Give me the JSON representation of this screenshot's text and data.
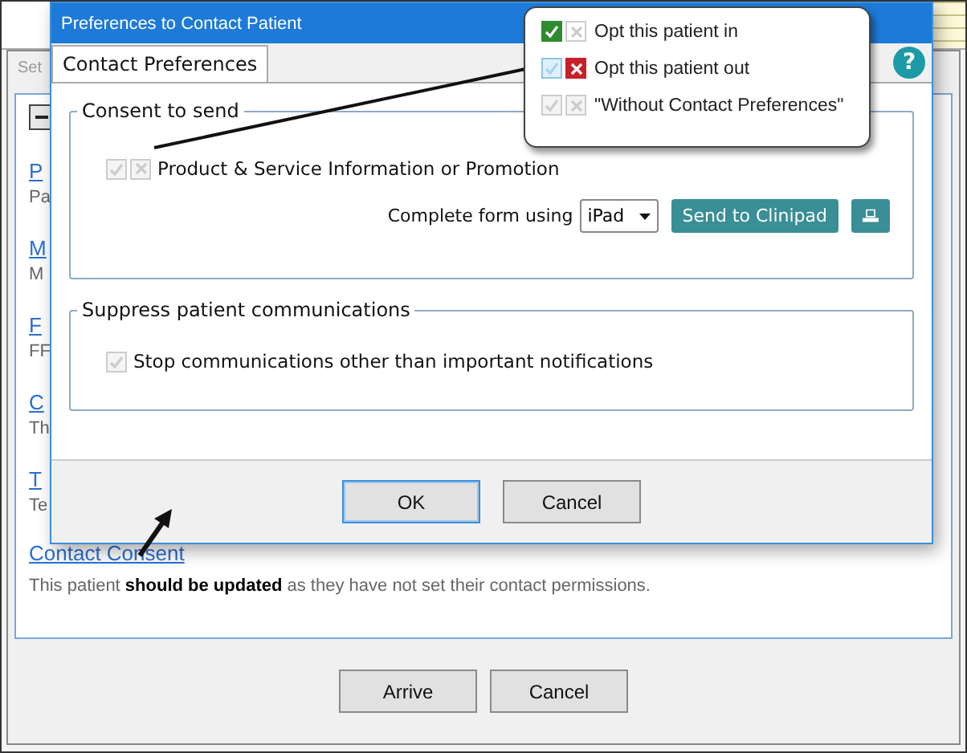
{
  "background_window": {
    "tab": "Set",
    "items": [
      {
        "kind": "link",
        "text": "P"
      },
      {
        "kind": "text",
        "text": "Pa"
      },
      {
        "kind": "link",
        "text": "M"
      },
      {
        "kind": "text",
        "text": "M"
      },
      {
        "kind": "link",
        "text": "F"
      },
      {
        "kind": "text",
        "text": "FF"
      },
      {
        "kind": "link",
        "text": "C"
      },
      {
        "kind": "text",
        "text": "Th"
      },
      {
        "kind": "link",
        "text": "T"
      },
      {
        "kind": "text",
        "text": "Te"
      }
    ],
    "consent_link": "Contact Consent",
    "consent_note": "This patient **should be updated** as they have not set their contact permissions.",
    "buttons": [
      "Arrive",
      "Cancel"
    ]
  },
  "dialog": {
    "title": "Preferences to Contact Patient",
    "tabs": [
      {
        "label": "Contact Preferences",
        "selected": true
      }
    ],
    "help": "?",
    "sections": [
      {
        "kind": "consent",
        "title": "Consent to send",
        "options": [
          {
            "label": "Product & Service Information or Promotion",
            "tick": false,
            "cross": false
          }
        ],
        "complete_form_label": "Complete form using",
        "device": "iPad",
        "send_button": "Send to Clinipad"
      },
      {
        "kind": "suppress",
        "title": "Suppress patient communications",
        "options": [
          {
            "label": "Stop communications other than important notifications",
            "checked": false
          }
        ]
      }
    ],
    "buttons": [
      {
        "label": "OK",
        "default": true
      },
      {
        "label": "Cancel",
        "default": false
      }
    ]
  },
  "callout": {
    "items": [
      {
        "label": "Opt this patient in",
        "tick": true,
        "cross": false
      },
      {
        "label": "Opt this patient out",
        "tick": false,
        "cross": true
      },
      {
        "label": "\"Without Contact Preferences\"",
        "tick": false,
        "cross": false
      }
    ]
  }
}
